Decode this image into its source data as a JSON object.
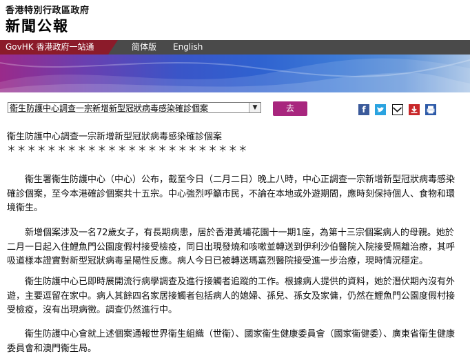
{
  "header": {
    "gov_name": "香港特別行政區政府",
    "site_title": "新聞公報"
  },
  "nav": {
    "gov_link": "GovHK 香港政府一站通",
    "simplified": "简体版",
    "english": "English"
  },
  "toolbar": {
    "select_value": "衞生防護中心調查一宗新增新型冠狀病毒感染確診個案",
    "go_label": "去",
    "share_icons": [
      "facebook-icon",
      "twitter-icon",
      "email-icon",
      "download-icon",
      "print-icon"
    ]
  },
  "article": {
    "title": "衞生防護中心調查一宗新增新型冠狀病毒感染確診個案",
    "stars": "＊＊＊＊＊＊＊＊＊＊＊＊＊＊＊＊＊＊＊＊＊＊＊＊",
    "p1": "衞生署衞生防護中心（中心）公布，截至今日（二月二日）晚上八時，中心正調查一宗新增新型冠狀病毒感染確診個案，至今本港確診個案共十五宗。中心強烈呼籲市民，不論在本地或外遊期間，應時刻保持個人、食物和環境衞生。",
    "p2": "新增個案涉及一名72歲女子，有長期病患，居於香港黃埔花園十一期1座，為第十三宗個案病人的母親。她於二月一日起入住鯉魚門公園度假村接受檢疫，同日出現發燒和咳嗽並轉送到伊利沙伯醫院入院接受隔離治療，其呼吸道樣本證實對新型冠狀病毒呈陽性反應。病人今日已被轉送瑪嘉烈醫院接受進一步治療，現時情況穩定。",
    "p3": "衞生防護中心已即時展開流行病學調查及進行接觸者追蹤的工作。根據病人提供的資料，她於潛伏期內沒有外遊，主要逗留在家中。病人其餘四名家居接觸者包括病人的媳婦、孫兒、孫女及家傭，仍然在鯉魚門公園度假村接受檢疫，沒有出現病徵。調查仍然進行中。",
    "p4": "衞生防護中心會就上述個案通報世界衞生組織（世衞）、國家衞生健康委員會（國家衞健委）、廣東省衞生健康委員會和澳門衞生局。"
  },
  "colors": {
    "nav_gov_bg": "#8b1b2a",
    "nav_bg": "#4a4a4a",
    "go_button": "#a8267e"
  }
}
